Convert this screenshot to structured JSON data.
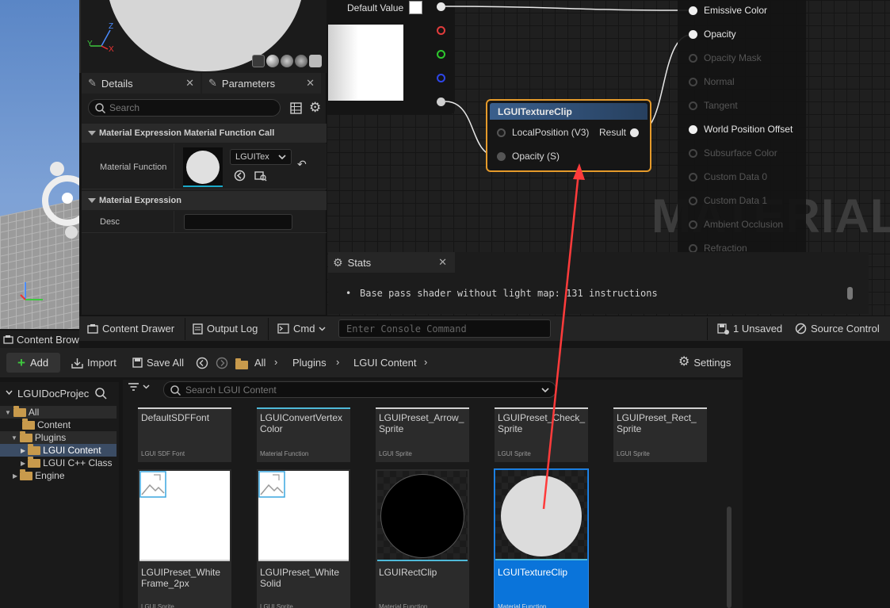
{
  "preview": {
    "axis_y": "Y",
    "axis_x": "X",
    "axis_z": "Z"
  },
  "details": {
    "tabs": [
      {
        "label": "Details"
      },
      {
        "label": "Parameters"
      }
    ],
    "search_placeholder": "Search",
    "section1": "Material Expression Material Function Call",
    "material_function_label": "Material Function",
    "material_function_value": "LGUITex",
    "section2": "Material Expression",
    "desc_label": "Desc"
  },
  "graph": {
    "default_value_label": "Default Value",
    "node_title": "LGUITextureClip",
    "node_input1": "LocalPosition (V3)",
    "node_output": "Result",
    "node_input2": "Opacity (S)",
    "watermark": "MATERIAL",
    "material_pins": [
      {
        "label": "Emissive Color",
        "active": true
      },
      {
        "label": "Opacity",
        "active": true
      },
      {
        "label": "Opacity Mask",
        "active": false
      },
      {
        "label": "Normal",
        "active": false
      },
      {
        "label": "Tangent",
        "active": false
      },
      {
        "label": "World Position Offset",
        "active": true
      },
      {
        "label": "Subsurface Color",
        "active": false
      },
      {
        "label": "Custom Data 0",
        "active": false
      },
      {
        "label": "Custom Data 1",
        "active": false
      },
      {
        "label": "Ambient Occlusion",
        "active": false
      },
      {
        "label": "Refraction",
        "active": false
      }
    ],
    "pin_colors": {
      "red": "#e23c3c",
      "green": "#2ec82e",
      "blue": "#2e46e8",
      "accent": "#e59a2a"
    }
  },
  "stats": {
    "tab_label": "Stats",
    "message": "Base pass shader without light map: 131 instructions"
  },
  "taskbar": {
    "content_drawer": "Content Drawer",
    "output_log": "Output Log",
    "cmd": "Cmd",
    "console_placeholder": "Enter Console Command",
    "unsaved": "1 Unsaved",
    "source_control": "Source Control"
  },
  "content_browser": {
    "tab_label": "Content Brow",
    "add": "Add",
    "import": "Import",
    "save_all": "Save All",
    "breadcrumb": [
      "All",
      "Plugins",
      "LGUI Content"
    ],
    "settings": "Settings",
    "search_placeholder": "Search LGUI Content",
    "project_label": "LGUIDocProjec",
    "tree": [
      "All",
      "Content",
      "Plugins",
      "LGUI Content",
      "LGUI C++ Class",
      "Engine"
    ],
    "assets": [
      {
        "name": "DefaultSDFFont",
        "type": "LGUI SDF Font"
      },
      {
        "name": "LGUIConvertVertex\nColor",
        "type": "Material Function"
      },
      {
        "name": "LGUIPreset_Arrow_\nSprite",
        "type": "LGUI Sprite"
      },
      {
        "name": "LGUIPreset_Check_\nSprite",
        "type": "LGUI Sprite"
      },
      {
        "name": "LGUIPreset_Rect_\nSprite",
        "type": "LGUI Sprite"
      },
      {
        "name": "LGUIPreset_White\nFrame_2px",
        "type": "LGUI Sprite"
      },
      {
        "name": "LGUIPreset_White\nSolid",
        "type": "LGUI Sprite"
      },
      {
        "name": "LGUIRectClip",
        "type": "Material Function"
      },
      {
        "name": "LGUITextureClip",
        "type": "Material Function"
      }
    ]
  }
}
